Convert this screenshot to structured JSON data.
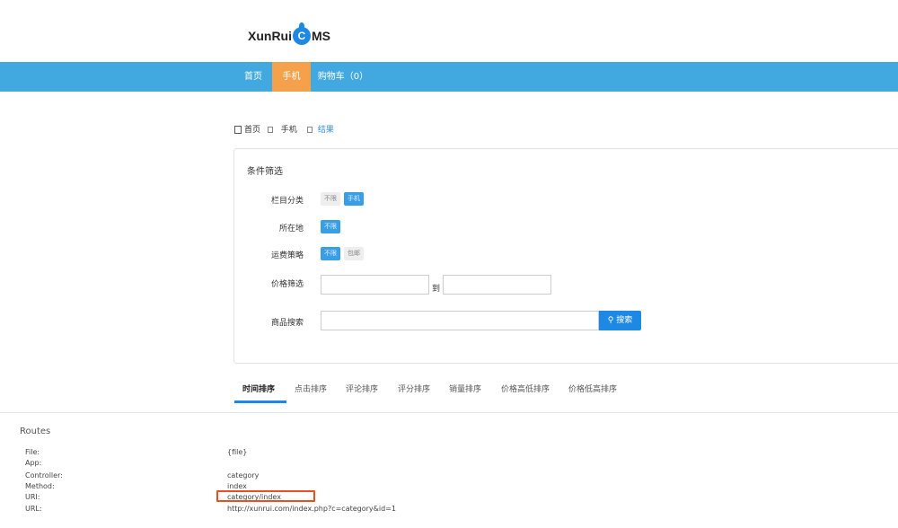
{
  "logo": {
    "text_a": "XunRui",
    "text_c": "C",
    "text_b": "MS"
  },
  "nav": {
    "items": [
      {
        "label": "首页"
      },
      {
        "label": "手机"
      },
      {
        "label": "购物车（0）"
      }
    ]
  },
  "breadcrumb": [
    {
      "label": "首页"
    },
    {
      "label": "手机"
    },
    {
      "label": "结果"
    }
  ],
  "filter": {
    "title": "条件筛选",
    "category": {
      "label": "栏目分类",
      "options": [
        "不限",
        "手机"
      ]
    },
    "location": {
      "label": "所在地",
      "options": [
        "不限"
      ]
    },
    "shipping": {
      "label": "运费策略",
      "options": [
        "不限",
        "包邮"
      ]
    },
    "price": {
      "label": "价格筛选",
      "to": "到",
      "min": "",
      "max": ""
    },
    "search": {
      "label": "商品搜索",
      "value": "",
      "button": "搜索"
    }
  },
  "sort_tabs": [
    "时间排序",
    "点击排序",
    "评论排序",
    "评分排序",
    "销量排序",
    "价格高低排序",
    "价格低高排序"
  ],
  "routes": {
    "title": "Routes",
    "rows": [
      {
        "key": "File:",
        "value": "{file}"
      },
      {
        "key": "App:",
        "value": ""
      },
      {
        "key": "Controller:",
        "value": "category"
      },
      {
        "key": "Method:",
        "value": "index"
      },
      {
        "key": "URI:",
        "value": "category/index"
      },
      {
        "key": "URL:",
        "value": "http://xunrui.com/index.php?c=category&id=1"
      }
    ]
  },
  "colors": {
    "nav": "#42a8e0",
    "nav_active": "#f5a14b",
    "accent": "#1e88e5",
    "highlight": "#e8511e"
  }
}
